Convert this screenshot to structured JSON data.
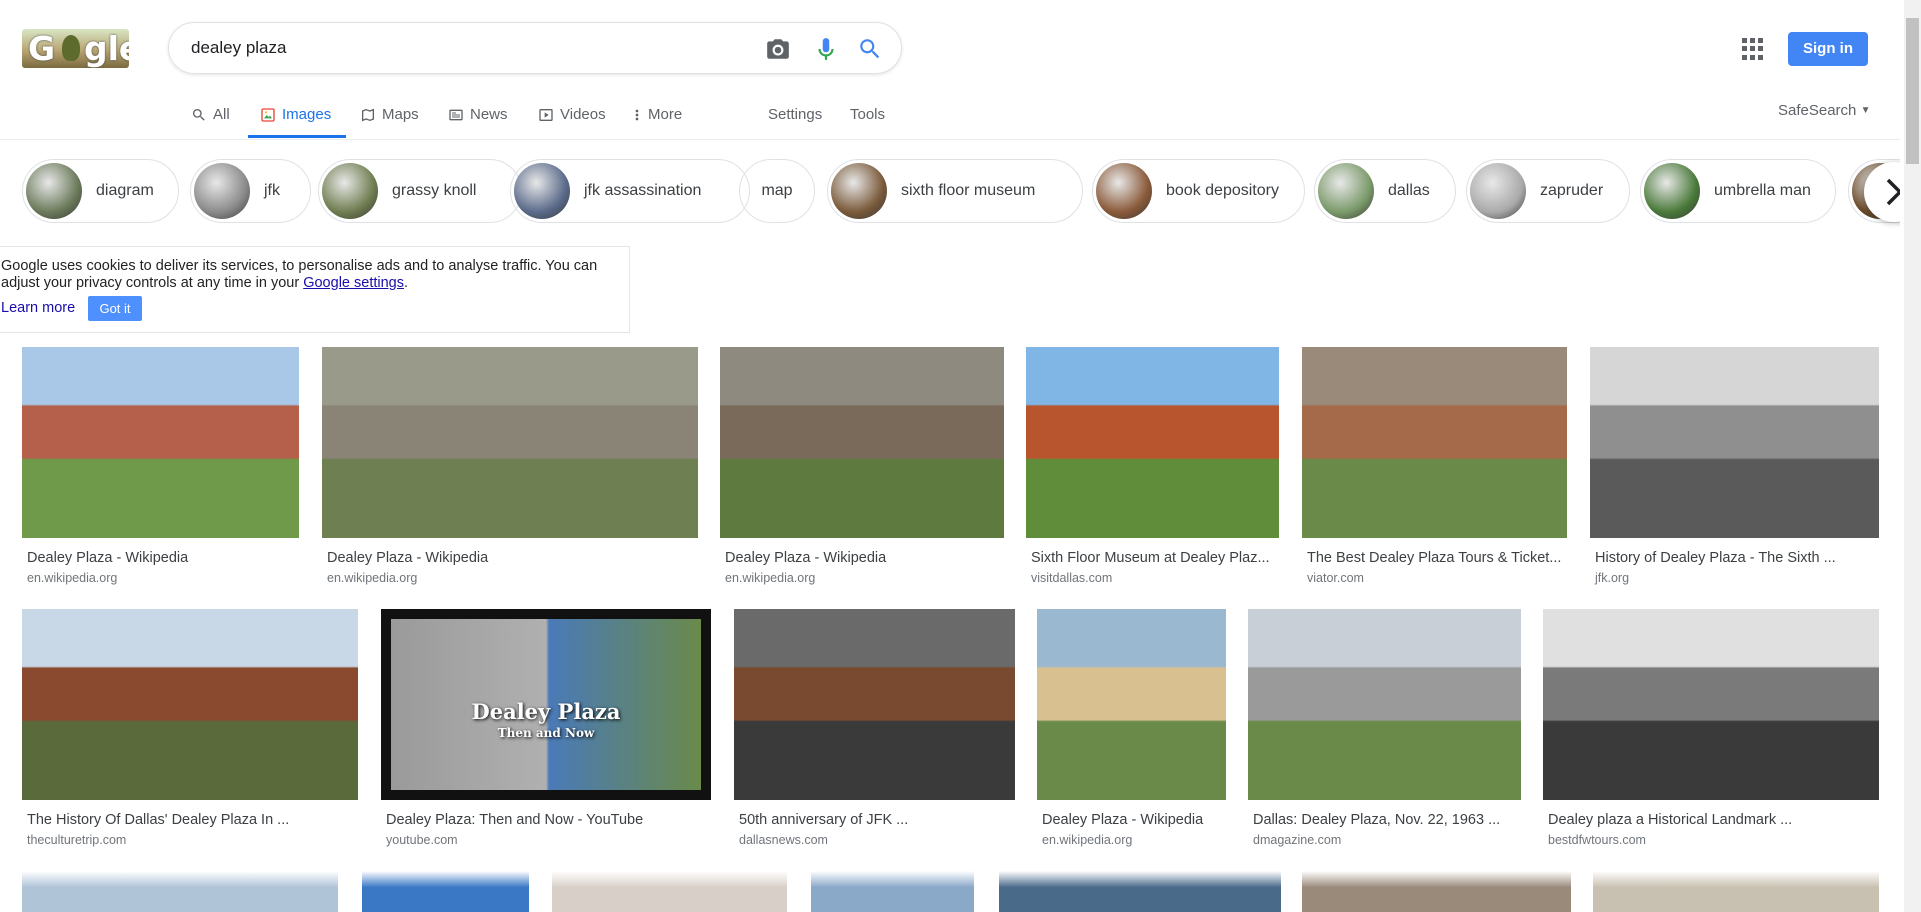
{
  "header": {
    "logo_text": "Google",
    "query": "dealey plaza",
    "signin_label": "Sign in"
  },
  "nav": {
    "tabs": [
      {
        "label": "All",
        "icon": "search-icon"
      },
      {
        "label": "Images",
        "icon": "image-icon",
        "active": true
      },
      {
        "label": "Maps",
        "icon": "map-icon"
      },
      {
        "label": "News",
        "icon": "news-icon"
      },
      {
        "label": "Videos",
        "icon": "video-icon"
      },
      {
        "label": "More",
        "icon": "more-vert-icon"
      }
    ],
    "settings_label": "Settings",
    "tools_label": "Tools",
    "safesearch_label": "SafeSearch"
  },
  "chips": [
    {
      "label": "diagram",
      "color": "#6b7a5a"
    },
    {
      "label": "jfk",
      "color": "#8a8a8a"
    },
    {
      "label": "grassy knoll",
      "color": "#6f7d50"
    },
    {
      "label": "jfk assassination",
      "color": "#5a6a8a"
    },
    {
      "label": "map",
      "color": ""
    },
    {
      "label": "sixth floor museum",
      "color": "#7a5a3a"
    },
    {
      "label": "book depository",
      "color": "#8a5a3a"
    },
    {
      "label": "dallas",
      "color": "#7b9a6a"
    },
    {
      "label": "zapruder",
      "color": "#aaaaaa"
    },
    {
      "label": "umbrella man",
      "color": "#4a7a3a"
    },
    {
      "label": "",
      "color": "#6a4a2a"
    }
  ],
  "cookie": {
    "text_1": "Google uses cookies to deliver its services, to personalise ads and to analyse traffic. You can adjust your privacy controls at any time in your ",
    "link": "Google settings",
    "text_2": ".",
    "learn_more": "Learn more",
    "got_it": "Got it"
  },
  "results": [
    {
      "title": "Dealey Plaza - Wikipedia",
      "source": "en.wikipedia.org",
      "colors": [
        "#a9c8e8",
        "#b5604a",
        "#6e9a4a"
      ]
    },
    {
      "title": "Dealey Plaza - Wikipedia",
      "source": "en.wikipedia.org",
      "colors": [
        "#9a9a8a",
        "#8a8476",
        "#6e7f52"
      ]
    },
    {
      "title": "Dealey Plaza - Wikipedia",
      "source": "en.wikipedia.org",
      "colors": [
        "#8e8a80",
        "#7a6a5a",
        "#5e7a3e"
      ]
    },
    {
      "title": "Sixth Floor Museum at Dealey Plaz...",
      "source": "visitdallas.com",
      "colors": [
        "#7fb6e6",
        "#b8542e",
        "#5f8d3a"
      ]
    },
    {
      "title": "The Best Dealey Plaza Tours & Ticket...",
      "source": "viator.com",
      "colors": [
        "#9a8a7a",
        "#a56a4a",
        "#6a8a4a"
      ]
    },
    {
      "title": "History of Dealey Plaza - The Sixth ...",
      "source": "jfk.org",
      "colors": [
        "#d6d6d6",
        "#8f8f8f",
        "#5a5a5a"
      ]
    },
    {
      "title": "The History Of Dallas' Dealey Plaza In ...",
      "source": "theculturetrip.com",
      "colors": [
        "#c9d8e6",
        "#8a4a30",
        "#5a6a3a"
      ]
    },
    {
      "title": "Dealey Plaza: Then and Now - YouTube",
      "source": "youtube.com",
      "colors": [
        "#111111",
        "#9a9a9a",
        "#6a8a4a"
      ],
      "overlay": "Dealey Plaza",
      "overlay_sub": "Then and Now"
    },
    {
      "title": "50th anniversary of JFK ...",
      "source": "dallasnews.com",
      "colors": [
        "#6a6a6a",
        "#7a4a30",
        "#3a3a3a"
      ]
    },
    {
      "title": "Dealey Plaza - Wikipedia",
      "source": "en.wikipedia.org",
      "colors": [
        "#9ab8d0",
        "#d8c090",
        "#6a8a4a"
      ]
    },
    {
      "title": "Dallas: Dealey Plaza, Nov. 22, 1963 ...",
      "source": "dmagazine.com",
      "colors": [
        "#c9cfd6",
        "#9a9a9a",
        "#6a8a4a"
      ]
    },
    {
      "title": "Dealey plaza a Historical Landmark ...",
      "source": "bestdfwtours.com",
      "colors": [
        "#e0e0e0",
        "#7a7a7a",
        "#3a3a3a"
      ]
    }
  ],
  "third_row_colors": [
    "#b0c4d8",
    "#3a78c6",
    "#d8d0c8",
    "#8aa8c8",
    "#4a6a8a",
    "#9a8a7a",
    "#c8c0b0"
  ]
}
